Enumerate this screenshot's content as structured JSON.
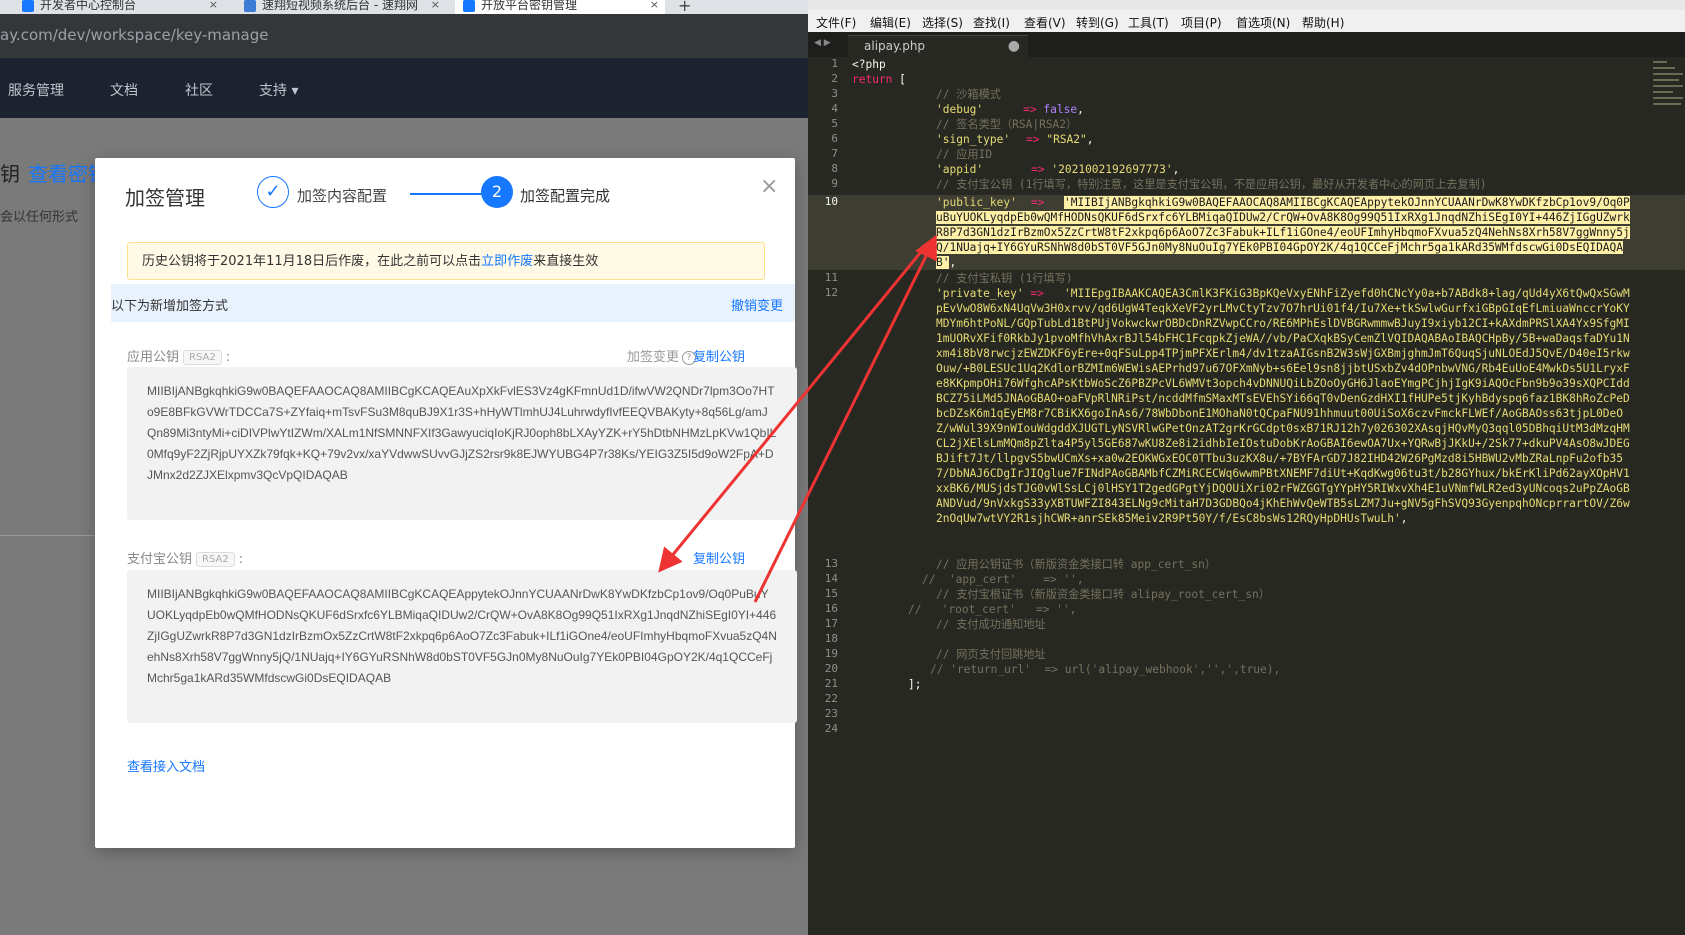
{
  "browser": {
    "tabs": [
      {
        "label": "开发者中心控制台"
      },
      {
        "label": "速翔短视频系统后台 - 速翔网"
      },
      {
        "label": "开放平台密钥管理"
      }
    ],
    "new_tab": "+",
    "close": "×",
    "url": "ay.com/dev/workspace/key-manage",
    "nav": [
      "服务管理",
      "文档",
      "社区",
      "支持 ▾"
    ],
    "bg_title_a": "钥",
    "bg_title_b": "查看密钥",
    "bg_note": "会以任何形式"
  },
  "modal": {
    "title": "加签管理",
    "step1_icon": "✓",
    "step1_label": "加签内容配置",
    "step2_number": "2",
    "step2_label": "加签配置完成",
    "close": "×",
    "alert_before": "历史公钥将于2021年11月18日后作废，在此之前可以点击",
    "alert_link": "立即作废",
    "alert_after": "来直接生效",
    "section_label": "以下为新增加签方式",
    "revoke_label": "撤销变更",
    "app_key_label": "应用公钥",
    "rsa_tag": "RSA2",
    "colon": ":",
    "sign_change_label": "加签变更",
    "help_icon": "?",
    "copy_label": "复制公钥",
    "app_key_value": "MIIBIjANBgkqhkiG9w0BAQEFAAOCAQ8AMIIBCgKCAQEAuXpXkFvlES3Vz4gKFmnUd1D/ifwVW2QNDr7lpm3Oo7HTo9E8BFkGVWrTDCCa7S+ZYfaiq+mTsvFSu3M8quBJ9X1r3S+hHyWTlmhUJ4LuhrwdyfIvfEEQVBAKyty+8q56Lg/amJQn89Mi3ntyMi+ciDIVPlwYtIZWm/XALm1NfSMNNFXIf3GawyuciqIoKjRJ0oph8bLXAyYZK+rY5hDtbNHMzLpKVw1QbIL0Mfq9yF2ZjRjpUYXZk79fqk+KQ+79v2vx/xaYVdwwSUvvGJjZS2rsr9k8EJWYUBG4P7r38Ks/YEIG3Z5I5d9oW2FpA+DJMnx2d2ZJXElxpmv3QcVpQIDAQAB",
    "alipay_key_label": "支付宝公钥",
    "alipay_key_value": "MIIBIjANBgkqhkiG9w0BAQEFAAOCAQ8AMIIBCgKCAQEAppytekOJnnYCUAANrDwK8YwDKfzbCp1ov9/Oq0PuBuYUOKLyqdpEb0wQMfHODNsQKUF6dSrxfc6YLBMiqaQIDUw2/CrQW+OvA8K8Og99Q51IxRXg1JnqdNZhiSEgI0YI+446ZjIGgUZwrkR8P7d3GN1dzIrBzmOx5ZzCrtW8tF2xkpq6p6AoO7Zc3Fabuk+ILf1iGOne4/eoUFImhyHbqmoFXvua5zQ4NehNs8Xrh58V7ggWnny5jQ/1NUajq+IY6GYuRSNhW8d0bST0VF5GJn0My8NuOuIg7YEk0PBI04GpOY2K/4q1QCCeFjMchr5ga1kARd35WMfdscwGi0DsEQIDAQAB",
    "docs_link": "查看接入文档"
  },
  "editor": {
    "menu": [
      "文件(F)",
      "编辑(E)",
      "选择(S)",
      "查找(I)",
      "查看(V)",
      "转到(G)",
      "工具(T)",
      "项目(P)",
      "首选项(N)",
      "帮助(H)"
    ],
    "nav_arrows": "◀ ▶",
    "tab_label": "alipay.php",
    "tab_dot": "●",
    "line_numbers": [
      "1",
      "2",
      "3",
      "4",
      "5",
      "6",
      "7",
      "8",
      "9",
      "10",
      "11",
      "12",
      "13",
      "14",
      "15",
      "16",
      "17",
      "18",
      "19",
      "20",
      "21",
      "22",
      "23",
      "24"
    ],
    "l1": "<?php",
    "l2_kw": "return",
    "l2_rest": " [",
    "l3": "// 沙箱模式",
    "l4_key": "'debug'",
    "l4_arrow": "=>",
    "l4_val": "false",
    "l5": "// 签名类型（RSA|RSA2）",
    "l6_key": "'sign_type'",
    "l6_val": "\"RSA2\"",
    "l7": "// 应用ID",
    "l8_key": "'appid'",
    "l8_val": "'2021002192697773'",
    "l9": "// 支付宝公钥 (1行填写，特别注意，这里是支付宝公钥，不是应用公钥，最好从开发者中心的网页上去复制)",
    "l10_key": "'public_key'",
    "l10_val": "'MIIBIjANBgkqhkiG9w0BAQEFAAOCAQ8AMIIBCgKCAQEAppytekOJnnYCUAANrDwK8YwDKfzbCp1ov9/Oq0PuBuYUOKLyqdpEb0wQMfHODNsQKUF6dSrxfc6YLBMiqaQIDUw2/CrQW+OvA8K8Og99Q51IxRXg1JnqdNZhiSEgI0YI+446ZjIGgUZwrkR8P7d3GN1dzIrBzmOx5ZzCrtW8tF2xkpq6p6AoO7Zc3Fabuk+ILf1iGOne4/eoUFImhyHbqmoFXvua5zQ4NehNs8Xrh58V7ggWnny5jQ/1NUajq+IY6GYuRSNhW8d0bST0VF5GJn0My8NuOuIg7YEk0PBI04GpOY2K/4q1QCCeFjMchr5ga1kARd35WMfdscwGi0DsEQIDAQAB'",
    "l11": "// 支付宝私钥 (1行填写)",
    "l12_key": "'private_key'",
    "l12_val": "'MIIEpgIBAAKCAQEA3CmlK3FKiG3BpKQeVxyENhFiZyefd0hCNcYy0a+b7ABdk8+lag/qUd4yX6tQwQxSGwMpEvVwO8W6xN4UqVw3H0xrvv/qd6UgW4TeqkXeVF2yrLMvCtyTzv7O7hrUi01f4/Iu7Xe+tkSwlwGurfxiGBpGIqEfLmiuaWnccrYoKYMDYm6htPoNL/GQpTubLd1BtPUjVokwckwrOBDcDnRZVwpCCro/RE6MPhEslDVBGRwmmwBJuyI9xiyb12CI+kAXdmPRSlXA4Yx9SfgMI1mUORvXFif0RkbJy1pvoMfhVhAxrBJl54bFHC1FcqpkZjeWA//vb/PaCXqkBSyCemZlVQIDAQABAoIBAQCHpBy/5B+waDaqsfaDYu1Nxm4i8bV8rwcjzEWZDKF6yEre+0qFSuLpp4TPjmPFXErlm4/dv1tzaAIGsnB2W3sWjGXBmjghmJmT6QuqSjuNLOEdJ5QvE/D40eI5rkwOuw/+B0LESUc1Uq2KdlorBZMIm6WEWisAEPrhd97u67OFXmNyb+s6Eel9sn8jjbtUSxbZv4dOPnbwVNG/Rb4EuUoE4MwkDs5U1LryxFe8KKpmpOHi76WfghcAPsKtbWoScZ6PBZPcVL6WMVt3opch4vDNNUQiLbZOoOyGH6JlaoEYmgPCjhjIgK9iAQOcFbn9b9o39sXQPCIddBCZ75iLMd5JNAoGBAO+oaFVpRlNRiPst/ncddMfmSMaxMTsEVEhSYi66qT0vDenGzdHXI1fHUPe5tjKyhBdyspq6faz1BK8hRoZcPeDbcDZsK6m1qEyEM8r7CBiKX6goInAs6/78WbDbonE1MOhaN0tQCpaFNU91hhmuut00UiSoX6czvFmckFLWEf/AoGBAOss63tjpL0DeOZ/wWul39X9nWIouWdgddXJUGTLyNSVRlwGPetOnzAT2grKrGCdpt0sxB71RJ12h7y026302XAsqjHQvMyQ3qql05DBhqiUtM3dMzqHMCL2jXElsLmMQm8pZlta4P5yl5GE687wKU8Ze8i2idhbIeIOstuDobKrAoGBAI6ewOA7Ux+YQRwBjJKkU+/2Sk77+dkuPV4AsO8wJDEGBJift7Jt/llpgvS5bwUCmXs+xa0w2EOKWGxEOC0TTbu3uzKX8u/+7BYFArGD7J82IHD42W26PgMzd8i5HBWU2vMbZRaLnpFu2ofb357/DbNAJ6CDgIrJIQglue7FINdPAoGBAMbfCZMiRCECWq6wwmPBtXNEMF7diUt+KqdKwg06tu3t/b28GYhux/bkErKliPd62ayXOpHV1xxBK6/MUSjdsTJG0vWlSsLCj0lHSY1T2gedGPgtYjDQOUiXri02rFWZGGTgYYpHY5RIWxvXh4E1uVNmfWLR2ed3yUNcoqs2uPpZAoGBANDVud/9nVxkgS33yXBTUWFZI843ELNg9cMitaH7D3GDBQo4jKhEhWvQeWTB5sLZM7Ju+gNV5gFhSVQ93GyenpqhONcprrartOV/Z6w2nOqUw7wtVY2R1sjhCWR+anrSEk85Meiv2R9Pt50Y/f/EsC8bsWs12RQyHpDHUsTwuLh'",
    "l13": "// 应用公钥证书（新版资金类接口转 app_cert_sn）",
    "l14": "//  'app_cert'    => '',",
    "l15": "// 支付宝根证书（新版资金类接口转 alipay_root_cert_sn）",
    "l16": "//   'root_cert'   => '',",
    "l17": "// 支付成功通知地址",
    "l19": "// 网页支付回跳地址",
    "l20": "// 'return_url'  => url('alipay_webhook','',',true),",
    "l21": "];",
    "comma": ","
  },
  "colors": {
    "accent": "#1677ff",
    "editor_bg": "#272822",
    "comment": "#75715e",
    "string": "#e6db74",
    "keyword": "#f92672",
    "arrow_red": "#ee3333"
  }
}
